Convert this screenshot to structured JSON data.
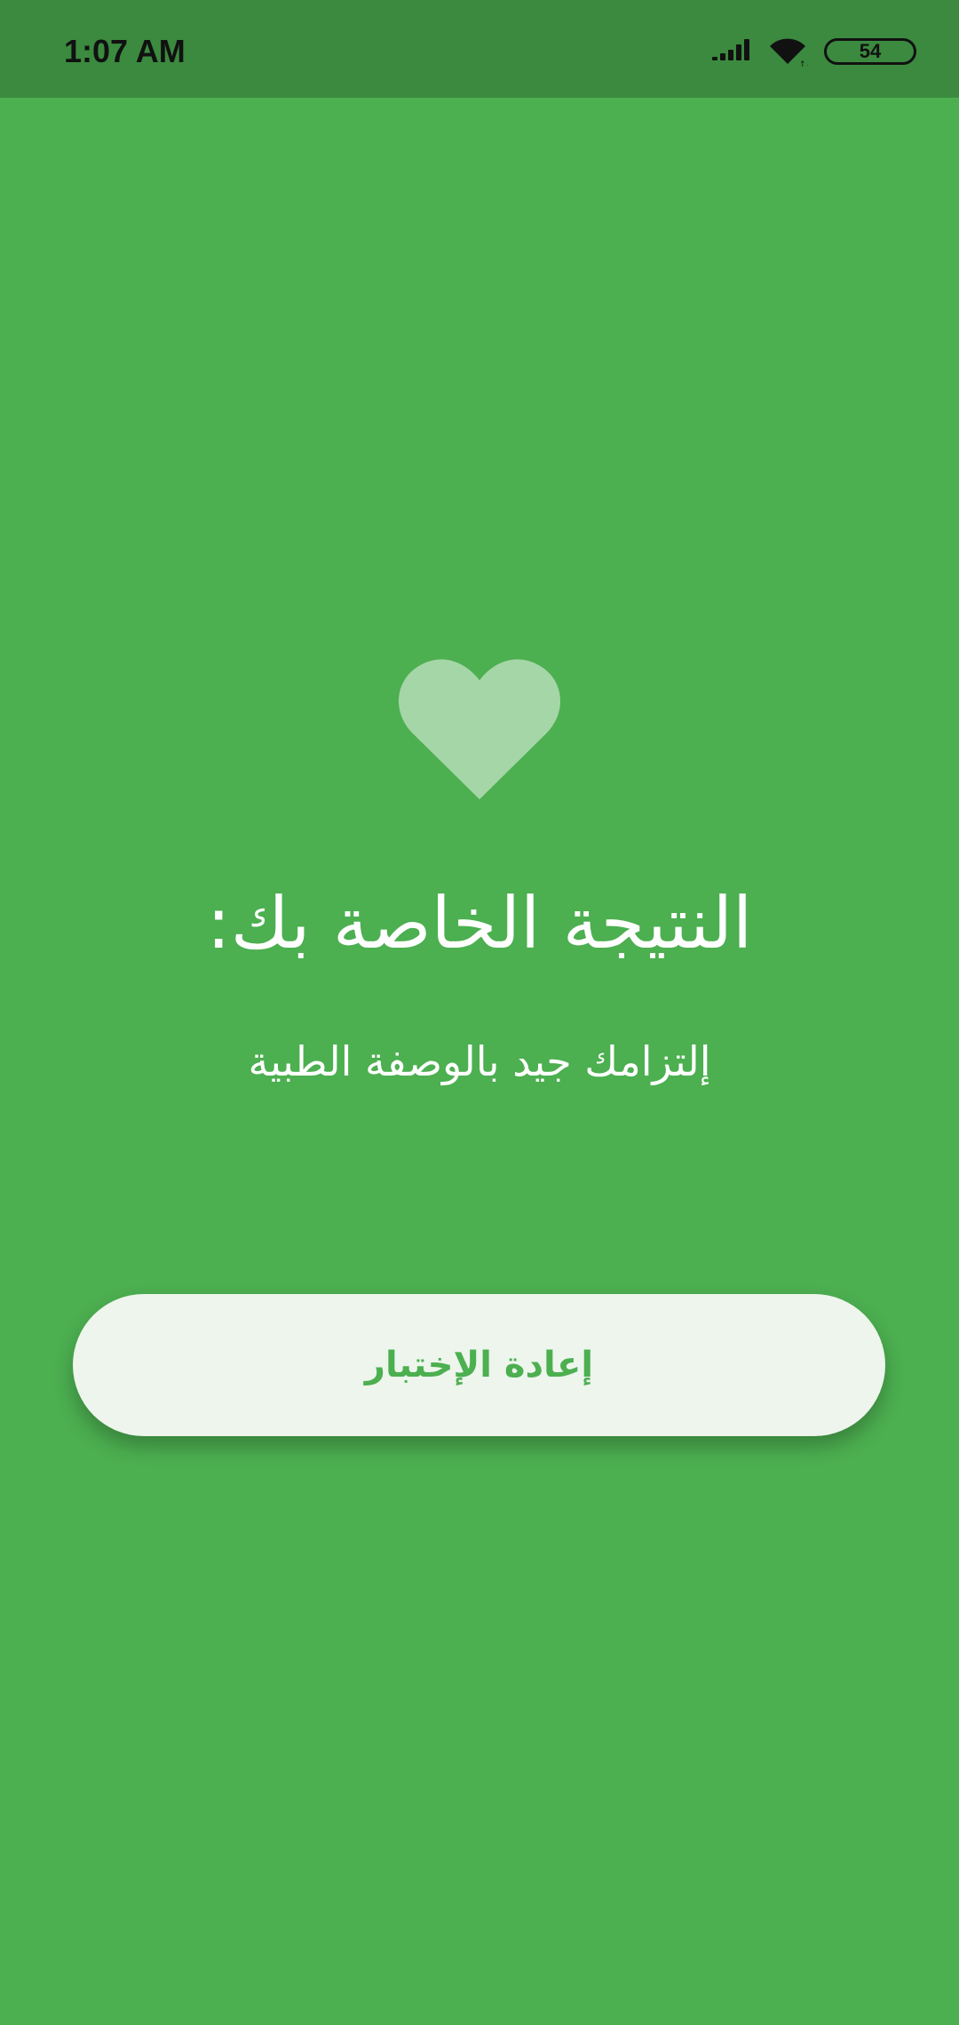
{
  "status_bar": {
    "time": "1:07 AM",
    "battery": "54",
    "icons": [
      "signal-icon",
      "wifi-icon",
      "battery-icon"
    ]
  },
  "result": {
    "icon": "heart-icon",
    "title": "النتيجة الخاصة بك:",
    "message": "إلتزامك جيد بالوصفة الطبية"
  },
  "actions": {
    "retry_label": "إعادة الإختبار"
  },
  "colors": {
    "background": "#4CAF50",
    "status_bar": "#3B8A3F",
    "heart": "#A5D6A7",
    "button_bg": "#EDF5EC",
    "button_text": "#4CAF50"
  }
}
